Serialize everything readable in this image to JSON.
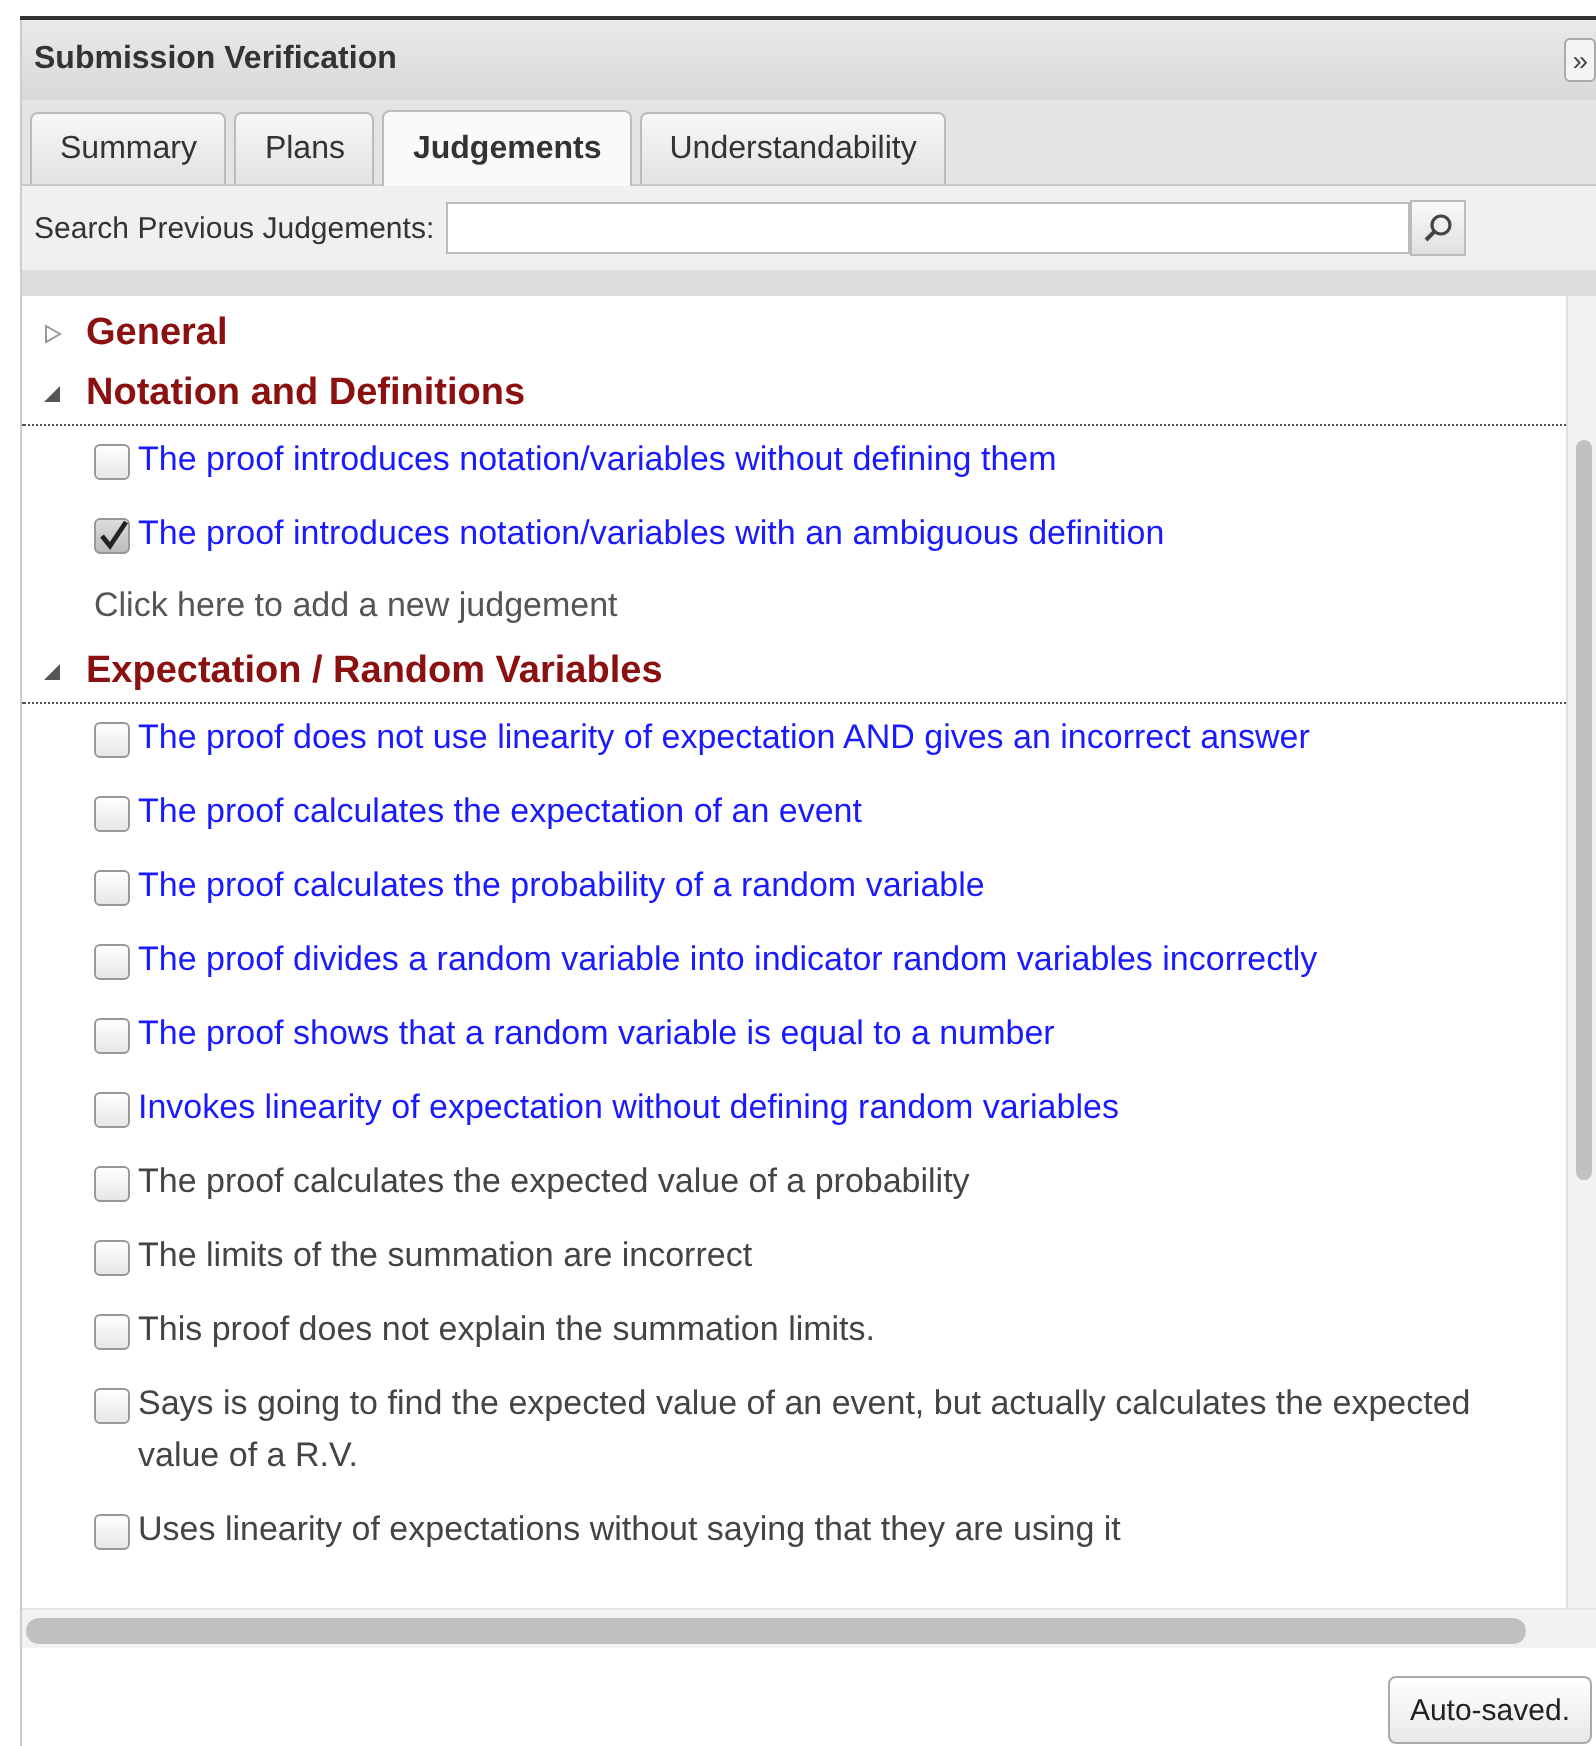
{
  "panel": {
    "title": "Submission Verification",
    "collapse_button": "»"
  },
  "tabs": [
    {
      "label": "Summary",
      "selected": false
    },
    {
      "label": "Plans",
      "selected": false
    },
    {
      "label": "Judgements",
      "selected": true
    },
    {
      "label": "Understandability",
      "selected": false
    }
  ],
  "search": {
    "label": "Search Previous Judgements:"
  },
  "sections": [
    {
      "title": "General",
      "expanded": false
    },
    {
      "title": "Notation and Definitions",
      "expanded": true,
      "items": [
        {
          "text": "The proof introduces notation/variables without defining them",
          "kind": "linked",
          "checked": false
        },
        {
          "text": "The proof introduces notation/variables with an ambiguous definition",
          "kind": "linked",
          "checked": true
        }
      ],
      "add_link": "Click here to add a new judgement"
    },
    {
      "title": "Expectation / Random Variables",
      "expanded": true,
      "items": [
        {
          "text": "The proof does not use linearity of expectation AND gives an incorrect answer",
          "kind": "linked",
          "checked": false
        },
        {
          "text": "The proof calculates the expectation of an event",
          "kind": "linked",
          "checked": false
        },
        {
          "text": "The proof calculates the probability of a random variable",
          "kind": "linked",
          "checked": false
        },
        {
          "text": "The proof divides a random variable into indicator random variables incorrectly",
          "kind": "linked",
          "checked": false
        },
        {
          "text": "The proof shows that a random variable is equal to a number",
          "kind": "linked",
          "checked": false
        },
        {
          "text": "Invokes linearity of expectation without defining random variables",
          "kind": "linked",
          "checked": false
        },
        {
          "text": "The proof calculates the expected value of a probability",
          "kind": "plain",
          "checked": false
        },
        {
          "text": "The limits of the summation are incorrect",
          "kind": "plain",
          "checked": false
        },
        {
          "text": "This proof does not explain the summation limits.",
          "kind": "plain",
          "checked": false
        },
        {
          "text": "Says is going to find the expected value of an event, but actually calculates the expected value of a R.V.",
          "kind": "plain",
          "checked": false
        },
        {
          "text": "Uses linearity of expectations without saying that they are using it",
          "kind": "plain",
          "checked": false
        }
      ]
    }
  ],
  "footer": {
    "status_button": "Auto-saved."
  }
}
